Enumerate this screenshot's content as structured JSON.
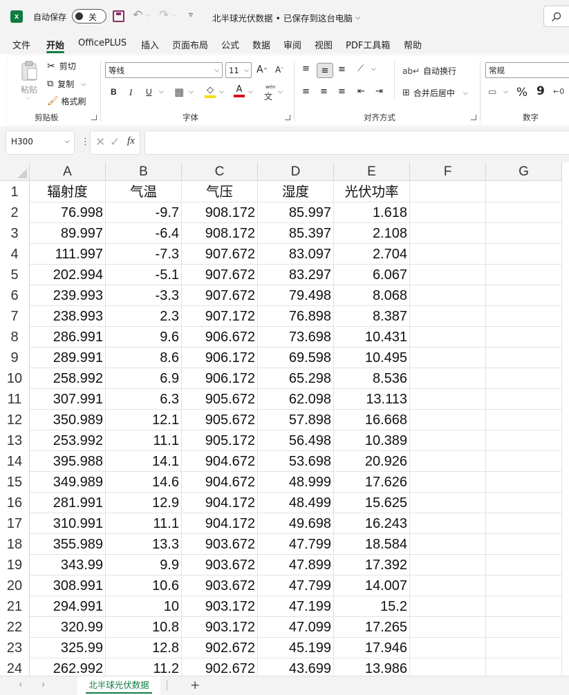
{
  "titlebar": {
    "app_icon": "excel-logo",
    "autosave_label": "自动保存",
    "autosave_state": "关",
    "doc_title": "北半球光伏数据 • 已保存到这台电脑",
    "search_icon": "search-icon"
  },
  "menu": {
    "items": [
      "文件",
      "开始",
      "OfficePLUS",
      "插入",
      "页面布局",
      "公式",
      "数据",
      "审阅",
      "视图",
      "PDF工具箱",
      "帮助"
    ],
    "active": "开始"
  },
  "ribbon": {
    "clipboard": {
      "paste": "粘贴",
      "cut": "剪切",
      "copy": "复制",
      "format_painter": "格式刷",
      "group": "剪贴板"
    },
    "font": {
      "name": "等线",
      "size": "11",
      "bold": "B",
      "italic": "I",
      "underline": "U",
      "group": "字体"
    },
    "align": {
      "wrap": "自动换行",
      "merge": "合并后居中",
      "group": "对齐方式"
    },
    "number": {
      "format": "常规",
      "percent": "%",
      "comma": "9",
      "group": "数字"
    }
  },
  "formula": {
    "namebox": "H300",
    "fx": "fx",
    "value": ""
  },
  "sheet": {
    "columns": [
      "A",
      "B",
      "C",
      "D",
      "E",
      "F",
      "G"
    ],
    "header_row": [
      "辐射度",
      "气温",
      "气压",
      "湿度",
      "光伏功率"
    ],
    "rows": [
      [
        "76.998",
        "-9.7",
        "908.172",
        "85.997",
        "1.618"
      ],
      [
        "89.997",
        "-6.4",
        "908.172",
        "85.397",
        "2.108"
      ],
      [
        "111.997",
        "-7.3",
        "907.672",
        "83.097",
        "2.704"
      ],
      [
        "202.994",
        "-5.1",
        "907.672",
        "83.297",
        "6.067"
      ],
      [
        "239.993",
        "-3.3",
        "907.672",
        "79.498",
        "8.068"
      ],
      [
        "238.993",
        "2.3",
        "907.172",
        "76.898",
        "8.387"
      ],
      [
        "286.991",
        "9.6",
        "906.672",
        "73.698",
        "10.431"
      ],
      [
        "289.991",
        "8.6",
        "906.172",
        "69.598",
        "10.495"
      ],
      [
        "258.992",
        "6.9",
        "906.172",
        "65.298",
        "8.536"
      ],
      [
        "307.991",
        "6.3",
        "905.672",
        "62.098",
        "13.113"
      ],
      [
        "350.989",
        "12.1",
        "905.672",
        "57.898",
        "16.668"
      ],
      [
        "253.992",
        "11.1",
        "905.172",
        "56.498",
        "10.389"
      ],
      [
        "395.988",
        "14.1",
        "904.672",
        "53.698",
        "20.926"
      ],
      [
        "349.989",
        "14.6",
        "904.672",
        "48.999",
        "17.626"
      ],
      [
        "281.991",
        "12.9",
        "904.172",
        "48.499",
        "15.625"
      ],
      [
        "310.991",
        "11.1",
        "904.172",
        "49.698",
        "16.243"
      ],
      [
        "355.989",
        "13.3",
        "903.672",
        "47.799",
        "18.584"
      ],
      [
        "343.99",
        "9.9",
        "903.672",
        "47.899",
        "17.392"
      ],
      [
        "308.991",
        "10.6",
        "903.672",
        "47.799",
        "14.007"
      ],
      [
        "294.991",
        "10",
        "903.172",
        "47.199",
        "15.2"
      ],
      [
        "320.99",
        "10.8",
        "903.172",
        "47.099",
        "17.265"
      ],
      [
        "325.99",
        "12.8",
        "902.672",
        "45.199",
        "17.946"
      ],
      [
        "262.992",
        "11.2",
        "902.672",
        "43.699",
        "13.986"
      ]
    ],
    "tab_name": "北半球光伏数据",
    "add_sheet": "+"
  },
  "colors": {
    "accent": "#107c41",
    "chrome": "#f3f3f3"
  }
}
